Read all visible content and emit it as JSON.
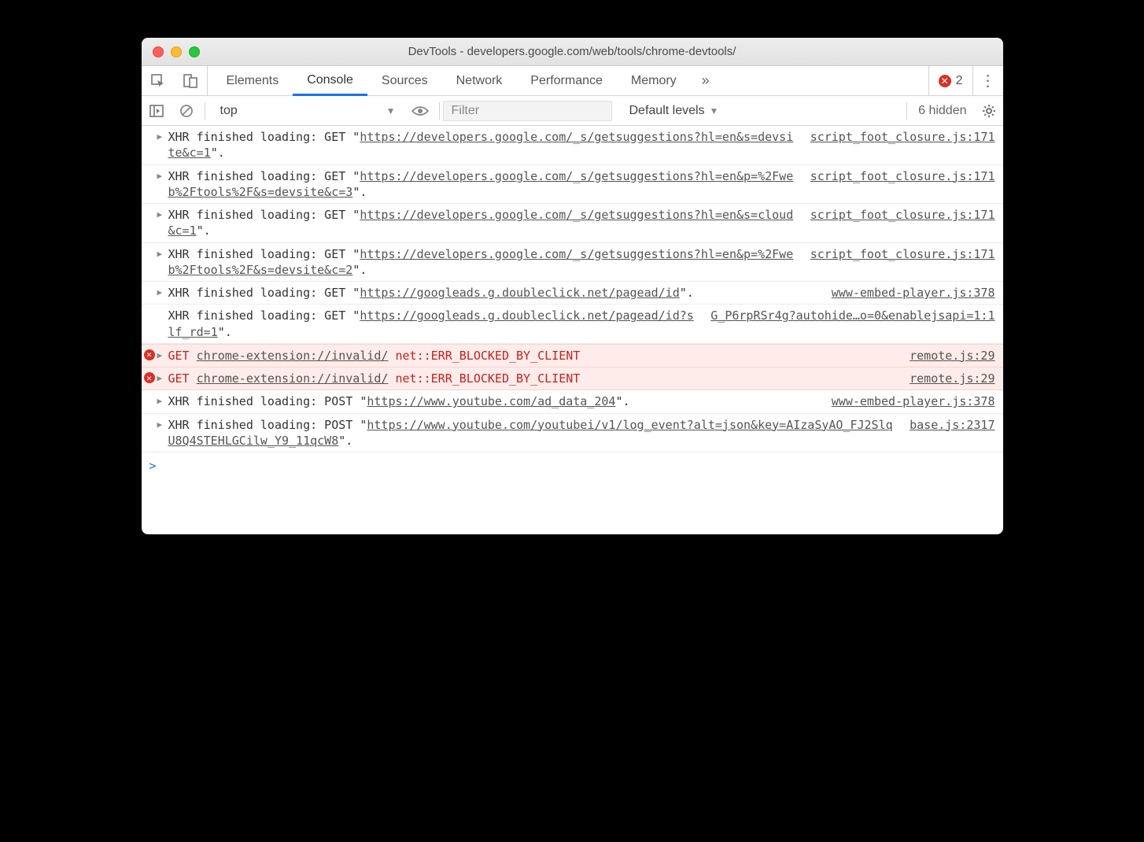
{
  "window": {
    "title": "DevTools - developers.google.com/web/tools/chrome-devtools/"
  },
  "tabs": {
    "items": [
      "Elements",
      "Console",
      "Sources",
      "Network",
      "Performance",
      "Memory"
    ],
    "activeIndex": 1,
    "errorCount": "2"
  },
  "toolbar": {
    "context": "top",
    "filterPlaceholder": "Filter",
    "levels": "Default levels",
    "hidden": "6 hidden"
  },
  "messages": [
    {
      "type": "xhr",
      "disc": true,
      "prefix": "XHR finished loading: GET \"",
      "url": "https://developers.google.com/_s/getsuggestions?hl=en&s=devsite&c=1",
      "suffix": "\".",
      "source": "script_foot_closure.js:171"
    },
    {
      "type": "xhr",
      "disc": true,
      "prefix": "XHR finished loading: GET \"",
      "url": "https://developers.google.com/_s/getsuggestions?hl=en&p=%2Fweb%2Ftools%2F&s=devsite&c=3",
      "suffix": "\".",
      "source": "script_foot_closure.js:171"
    },
    {
      "type": "xhr",
      "disc": true,
      "prefix": "XHR finished loading: GET \"",
      "url": "https://developers.google.com/_s/getsuggestions?hl=en&s=cloud&c=1",
      "suffix": "\".",
      "source": "script_foot_closure.js:171"
    },
    {
      "type": "xhr",
      "disc": true,
      "prefix": "XHR finished loading: GET \"",
      "url": "https://developers.google.com/_s/getsuggestions?hl=en&p=%2Fweb%2Ftools%2F&s=devsite&c=2",
      "suffix": "\".",
      "source": "script_foot_closure.js:171"
    },
    {
      "type": "xhr",
      "disc": true,
      "prefix": "XHR finished loading: GET \"",
      "url": "https://googleads.g.doubleclick.net/pagead/id",
      "suffix": "\".",
      "source": "www-embed-player.js:378"
    },
    {
      "type": "xhr",
      "disc": false,
      "prefix": "XHR finished loading: GET \"",
      "url": "https://googleads.g.doubleclick.net/pagead/id?slf_rd=1",
      "suffix": "\".",
      "source": "G_P6rpRSr4g?autohide…o=0&enablejsapi=1:1"
    },
    {
      "type": "error",
      "disc": true,
      "method": "GET",
      "url": "chrome-extension://invalid/",
      "err": "net::ERR_BLOCKED_BY_CLIENT",
      "source": "remote.js:29"
    },
    {
      "type": "error",
      "disc": true,
      "method": "GET",
      "url": "chrome-extension://invalid/",
      "err": "net::ERR_BLOCKED_BY_CLIENT",
      "source": "remote.js:29"
    },
    {
      "type": "xhr",
      "disc": true,
      "prefix": "XHR finished loading: POST \"",
      "url": "https://www.youtube.com/ad_data_204",
      "suffix": "\".",
      "source": "www-embed-player.js:378"
    },
    {
      "type": "xhr",
      "disc": true,
      "prefix": "XHR finished loading: POST \"",
      "url": "https://www.youtube.com/youtubei/v1/log_event?alt=json&key=AIzaSyAO_FJ2SlqU8Q4STEHLGCilw_Y9_11qcW8",
      "suffix": "\".",
      "source": "base.js:2317"
    }
  ],
  "prompt": ">"
}
